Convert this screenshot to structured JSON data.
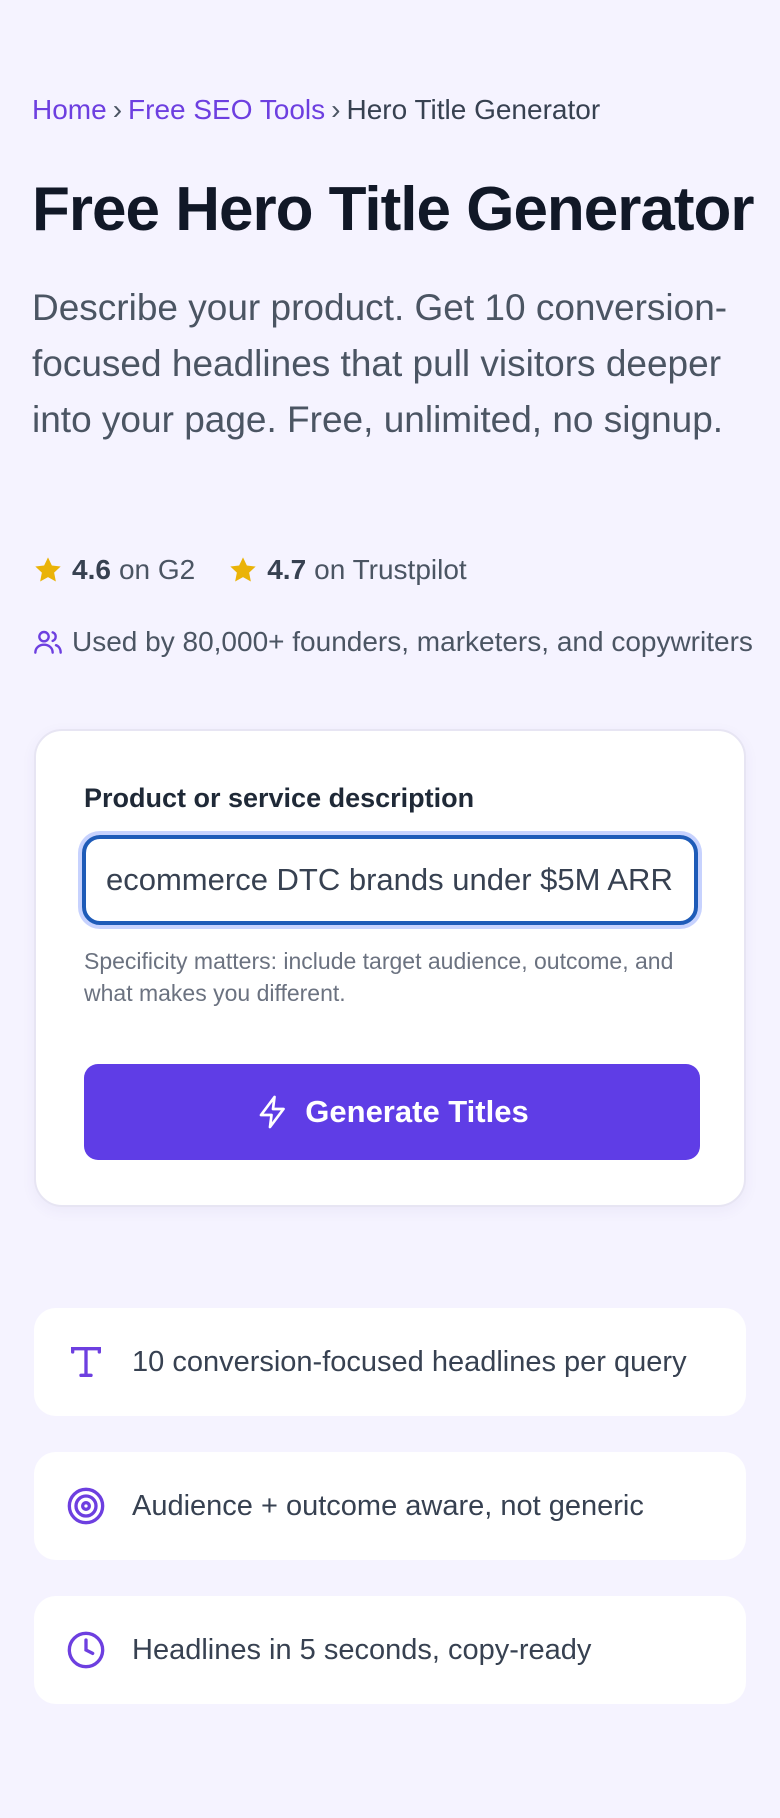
{
  "breadcrumb": {
    "home": "Home",
    "section": "Free SEO Tools",
    "current": "Hero Title Generator",
    "separator": "›"
  },
  "page_title": "Free Hero Title Generator",
  "subtitle": "Describe your product. Get 10 conversion-focused headlines that pull visitors deeper into your page. Free, unlimited, no signup.",
  "ratings": [
    {
      "score": "4.6",
      "text": "on G2",
      "icon": "star-icon"
    },
    {
      "score": "4.7",
      "text": "on Trustpilot",
      "icon": "star-icon"
    }
  ],
  "used_by": {
    "icon": "users-icon",
    "text": "Used by 80,000+ founders, marketers, and copywriters"
  },
  "form": {
    "label": "Product or service description",
    "input_value": "ecommerce DTC brands under $5M ARR",
    "hint": "Specificity matters: include target audience, outcome, and what makes you different.",
    "button_label": "Generate Titles",
    "button_icon": "lightning-icon"
  },
  "features": [
    {
      "icon": "text-t-icon",
      "text": "10 conversion-focused headlines per query"
    },
    {
      "icon": "target-icon",
      "text": "Audience + outcome aware, not generic"
    },
    {
      "icon": "clock-icon",
      "text": "Headlines in 5 seconds, copy-ready"
    }
  ],
  "colors": {
    "background": "#f5f3ff",
    "accent": "#5f3de6",
    "link": "#6d3fe0",
    "star": "#eab308",
    "input_focus": "#1e5bb8"
  }
}
